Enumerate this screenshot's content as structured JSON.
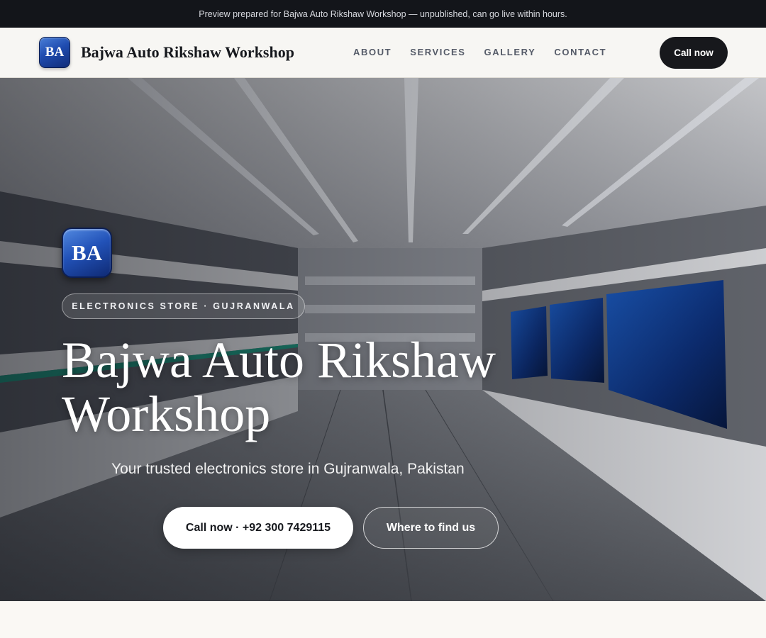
{
  "preview_banner": "Preview prepared for Bajwa Auto Rikshaw Workshop — unpublished, can go live within hours.",
  "header": {
    "logo_initials": "BA",
    "brand_name": "Bajwa Auto Rikshaw Workshop",
    "nav": [
      "ABOUT",
      "SERVICES",
      "GALLERY",
      "CONTACT"
    ],
    "cta_label": "Call now"
  },
  "hero": {
    "logo_initials": "BA",
    "category": "ELECTRONICS STORE · GUJRANWALA",
    "title": "Bajwa Auto Rikshaw Workshop",
    "subtitle": "Your trusted electronics store in Gujranwala, Pakistan",
    "primary_cta": "Call now · +92 300 7429115",
    "secondary_cta": "Where to find us"
  },
  "colors": {
    "accent_blue": "#1f4cb0",
    "dark": "#17181c",
    "banner_bg": "#13151a"
  }
}
